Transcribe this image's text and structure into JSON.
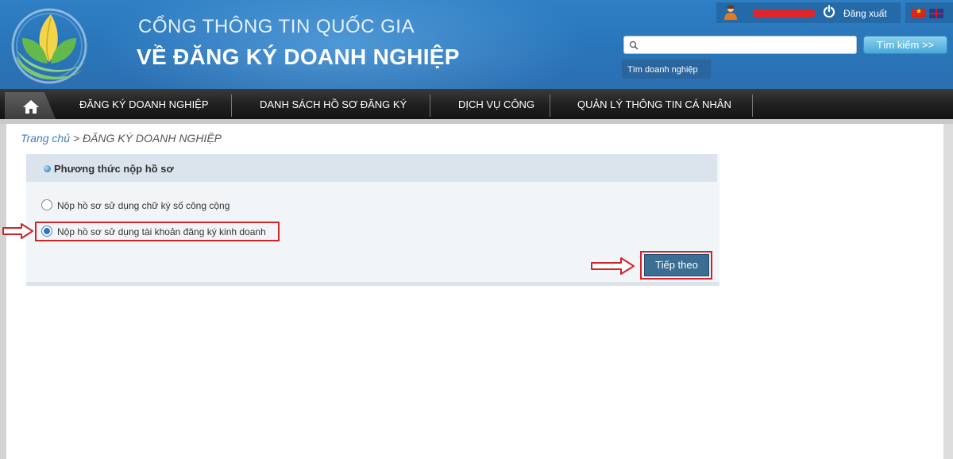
{
  "header": {
    "title_line1": "CỔNG THÔNG TIN QUỐC GIA",
    "title_line2": "VỀ ĐĂNG KÝ DOANH NGHIỆP",
    "user_name": "••••••",
    "logout_label": "Đăng xuất",
    "search": {
      "value": "",
      "placeholder": "",
      "button_label": "Tìm kiếm >>",
      "tab_label": "Tìm doanh nghiệp"
    }
  },
  "nav": {
    "items": [
      {
        "label": "ĐĂNG KÝ DOANH NGHIỆP"
      },
      {
        "label": "DANH SÁCH HỒ SƠ ĐĂNG KÝ"
      },
      {
        "label": "DỊCH VỤ CÔNG"
      },
      {
        "label": "QUẢN LÝ THÔNG TIN CÁ NHÂN"
      }
    ]
  },
  "breadcrumb": {
    "home": "Trang chủ",
    "separator": " > ",
    "current": "ĐĂNG KÝ DOANH NGHIỆP"
  },
  "panel": {
    "title": "Phương thức nộp hồ sơ",
    "options": [
      {
        "label": "Nộp hồ sơ sử dụng chữ ký số công cộng",
        "selected": false
      },
      {
        "label": "Nộp hồ sơ sử dụng tài khoản đăng ký kinh doanh",
        "selected": true
      }
    ],
    "next_label": "Tiếp theo"
  },
  "colors": {
    "header_blue": "#2b76bb",
    "nav_dark": "#1f1f1f",
    "annotation_red": "#d0232a",
    "button_blue": "#3c6e94"
  }
}
